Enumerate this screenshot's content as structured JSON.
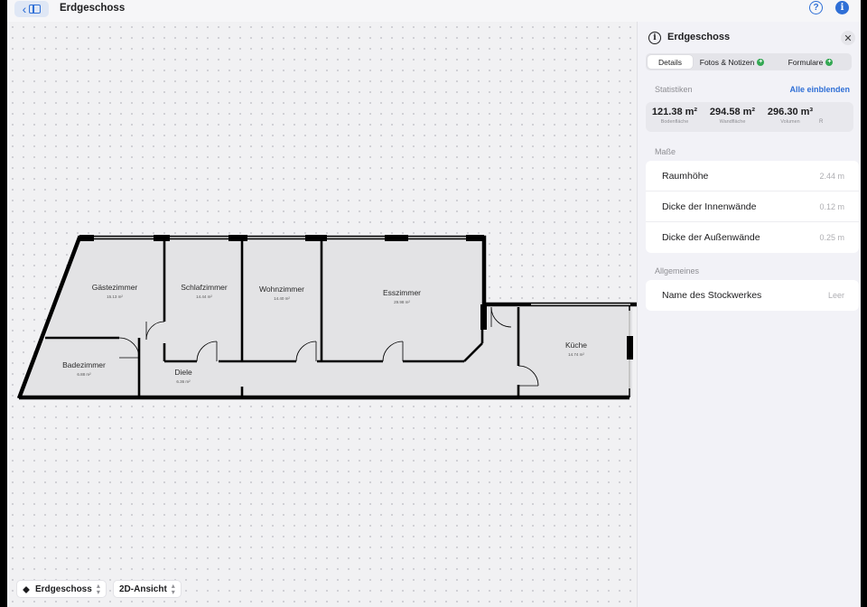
{
  "topbar": {
    "title": "Erdgeschoss"
  },
  "icons": {
    "back": "chevron-left-icon",
    "sidebar": "sidebar-icon",
    "help": "question-circle-icon",
    "info": "info-circle-icon",
    "close": "close-icon",
    "layers": "layers-icon"
  },
  "colors": {
    "accent": "#2f6fd6",
    "badge": "#34a853",
    "wall": "#000000",
    "room_fill": "#e3e3e5"
  },
  "floorplan": {
    "rooms": [
      {
        "name": "Gästezimmer",
        "area": "15.13 m²"
      },
      {
        "name": "Schlafzimmer",
        "area": "14.44 m²"
      },
      {
        "name": "Wohnzimmer",
        "area": "14.40 m²"
      },
      {
        "name": "Esszimmer",
        "area": "29.98 m²"
      },
      {
        "name": "Badezimmer",
        "area": "6.88 m²"
      },
      {
        "name": "Diele",
        "area": "6.36 m²"
      },
      {
        "name": "Küche",
        "area": "14.74 m²"
      }
    ]
  },
  "bottom_controls": {
    "floor_select": "Erdgeschoss",
    "view_select": "2D-Ansicht"
  },
  "panel": {
    "title": "Erdgeschoss",
    "tabs": [
      {
        "label": "Details",
        "badge": ""
      },
      {
        "label": "Fotos & Notizen",
        "badge": "+"
      },
      {
        "label": "Formulare",
        "badge": "+"
      }
    ],
    "statistics": {
      "label": "Statistiken",
      "show_all": "Alle einblenden",
      "items": [
        {
          "value": "121.38 m²",
          "label": "Bodenfläche"
        },
        {
          "value": "294.58 m²",
          "label": "Wandfläche"
        },
        {
          "value": "296.30 m³",
          "label": "Volumen"
        }
      ],
      "more_label": "R"
    },
    "measurements": {
      "label": "Maße",
      "rows": [
        {
          "label": "Raumhöhe",
          "value": "2.44 m"
        },
        {
          "label": "Dicke der Innenwände",
          "value": "0.12 m"
        },
        {
          "label": "Dicke der Außenwände",
          "value": "0.25 m"
        }
      ]
    },
    "general": {
      "label": "Allgemeines",
      "rows": [
        {
          "label": "Name des Stockwerkes",
          "value": "Leer"
        }
      ]
    }
  }
}
